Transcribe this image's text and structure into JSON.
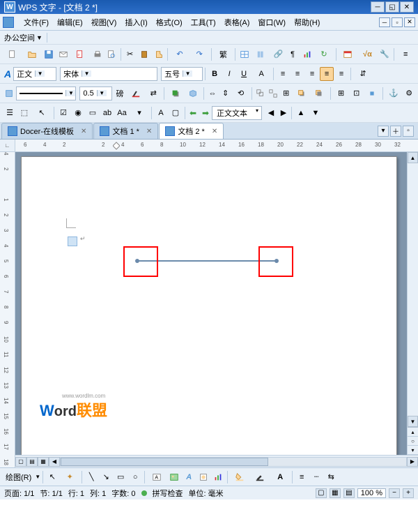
{
  "title": "WPS 文字 - [文档 2 *]",
  "menu": [
    "文件(F)",
    "编辑(E)",
    "视图(V)",
    "插入(I)",
    "格式(O)",
    "工具(T)",
    "表格(A)",
    "窗口(W)",
    "帮助(H)"
  ],
  "workspace": "办公空间",
  "format_bar": {
    "style_label": "正文",
    "font": "宋体",
    "size": "五号",
    "line_width": "0.5",
    "line_unit": "磅",
    "outline": "正文文本"
  },
  "tabs": [
    {
      "label": "Docer-在线模板",
      "active": false
    },
    {
      "label": "文档 1 *",
      "active": false
    },
    {
      "label": "文档 2 *",
      "active": true
    }
  ],
  "ruler_h": [
    "6",
    "4",
    "2",
    "",
    "2",
    "4",
    "6",
    "8",
    "10",
    "12",
    "14",
    "16",
    "18",
    "20",
    "22",
    "24",
    "26",
    "28",
    "30",
    "32"
  ],
  "ruler_v": [
    "4",
    "2",
    "",
    "1",
    "2",
    "3",
    "4",
    "5",
    "6",
    "7",
    "8",
    "9",
    "10",
    "11",
    "12",
    "13",
    "14",
    "15",
    "16",
    "17",
    "18"
  ],
  "watermark": {
    "w": "W",
    "ord": "ord",
    "rest": "联盟",
    "url": "www.wordlm.com"
  },
  "draw_label": "绘图(R)",
  "status": {
    "page": "页面: 1/1",
    "section": "节: 1/1",
    "row": "行: 1",
    "col": "列: 1",
    "chars": "字数: 0",
    "spell": "拼写检查",
    "unit": "单位: 毫米",
    "zoom": "100 %"
  }
}
